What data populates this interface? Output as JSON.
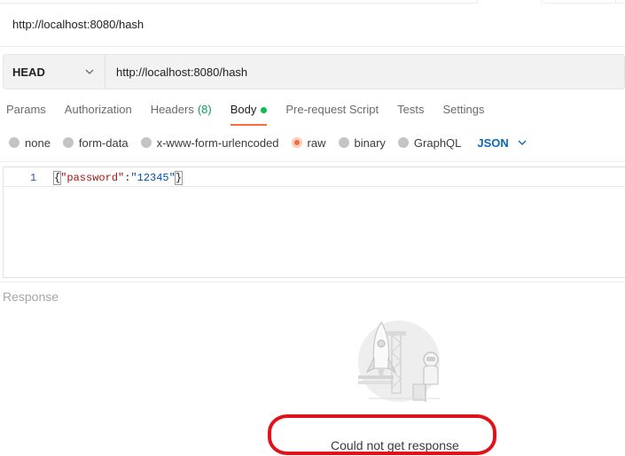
{
  "request_title": "http://localhost:8080/hash",
  "url_bar": {
    "method": "HEAD",
    "url": "http://localhost:8080/hash"
  },
  "tabs": [
    {
      "label": "Params"
    },
    {
      "label": "Authorization"
    },
    {
      "label": "Headers",
      "count": "(8)"
    },
    {
      "label": "Body",
      "active": true
    },
    {
      "label": "Pre-request Script"
    },
    {
      "label": "Tests"
    },
    {
      "label": "Settings"
    }
  ],
  "body_types": [
    {
      "label": "none"
    },
    {
      "label": "form-data"
    },
    {
      "label": "x-www-form-urlencoded"
    },
    {
      "label": "raw",
      "selected": true
    },
    {
      "label": "binary"
    },
    {
      "label": "GraphQL"
    }
  ],
  "language": "JSON",
  "editor": {
    "line_number": "1",
    "open_brace": "{",
    "key": "\"password\"",
    "colon": ":",
    "value": "\"12345\"",
    "close_brace": "}"
  },
  "response": {
    "label": "Response",
    "message": "Could not get response"
  },
  "colors": {
    "accent": "#ff6c37",
    "active_dot": "#0cbb52",
    "highlight_ring": "#e0121a",
    "language_link": "#0b69b4"
  }
}
